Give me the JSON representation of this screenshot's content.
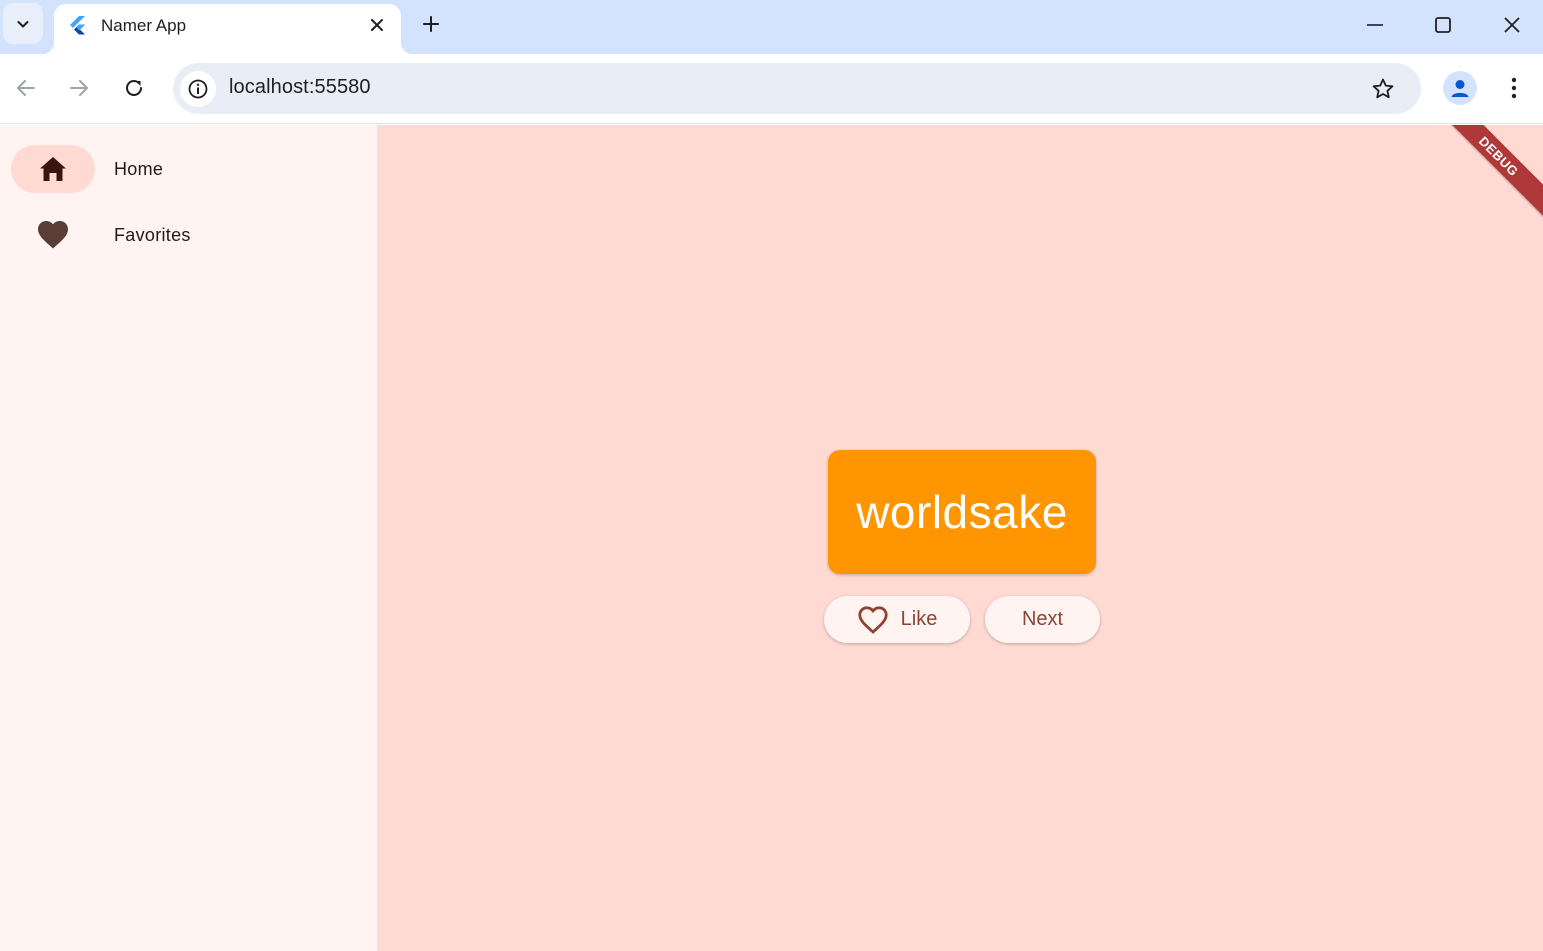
{
  "browser": {
    "tab": {
      "title": "Namer App"
    },
    "address": {
      "url": "localhost:55580"
    }
  },
  "app": {
    "nav": {
      "items": [
        {
          "label": "Home",
          "icon": "home-icon",
          "selected": true
        },
        {
          "label": "Favorites",
          "icon": "heart-icon",
          "selected": false
        }
      ]
    },
    "main": {
      "word": "worldsake",
      "like_label": "Like",
      "next_label": "Next"
    },
    "debug_banner": "DEBUG"
  },
  "colors": {
    "tabstrip": "#d3e3fd",
    "rail_background": "#fff4f2",
    "content_background": "#ffdad3",
    "card": "#ff9500",
    "button_text": "#8b4432",
    "debug_banner": "#b13838"
  }
}
